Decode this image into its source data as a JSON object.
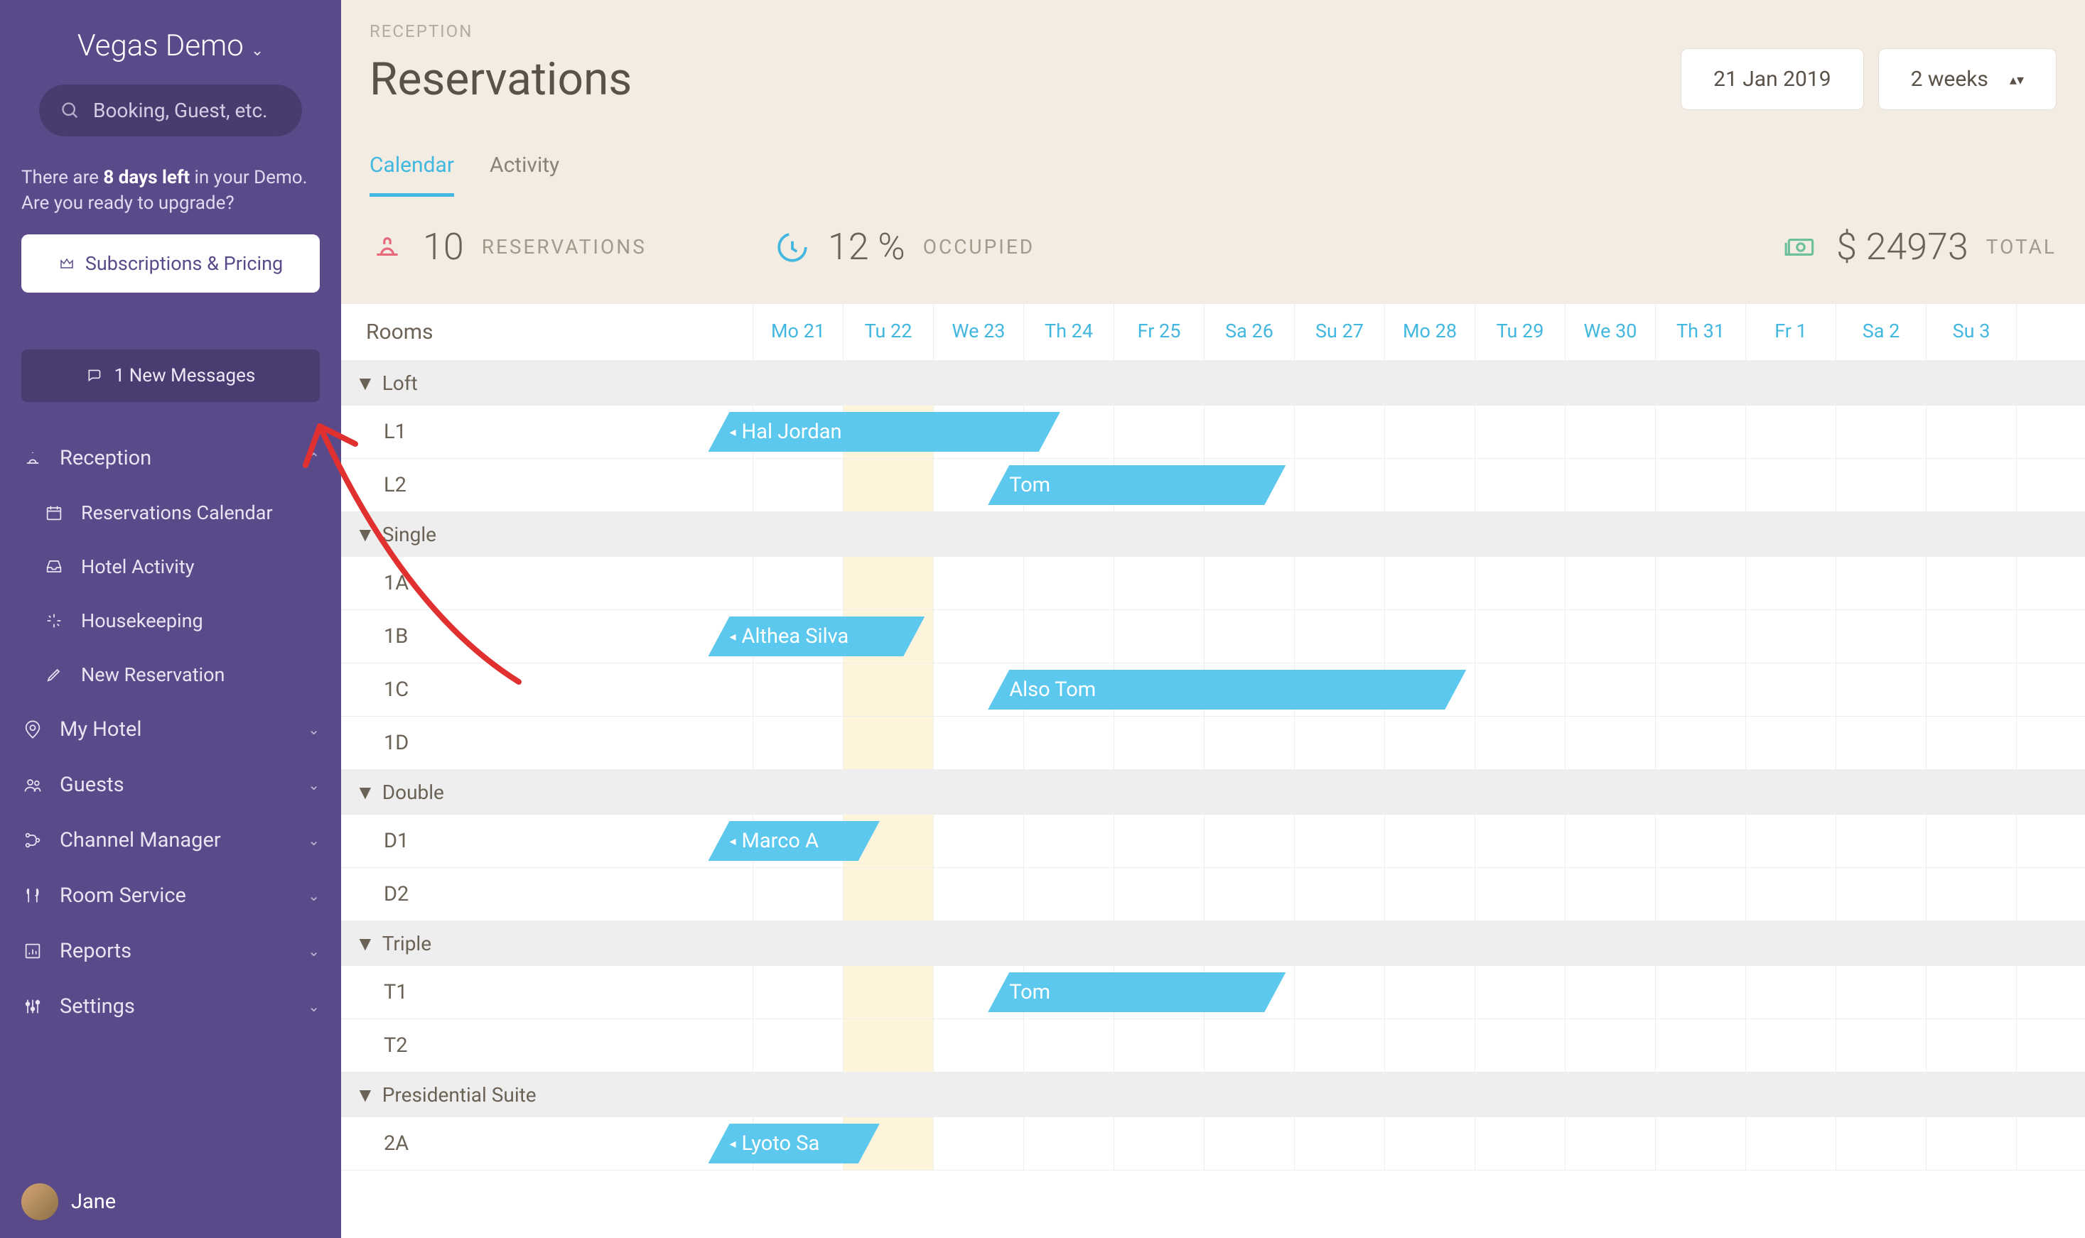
{
  "sidebar": {
    "org_name": "Vegas Demo",
    "search_placeholder": "Booking, Guest, etc.",
    "demo_note_prefix": "There are ",
    "demo_note_bold": "8 days left",
    "demo_note_suffix": " in your Demo. Are you ready to upgrade?",
    "pricing_button": "Subscriptions & Pricing",
    "messages_button": "1 New Messages",
    "nav": [
      {
        "label": "Reception",
        "icon": "bell",
        "expanded": true,
        "children": [
          {
            "label": "Reservations Calendar",
            "icon": "calendar"
          },
          {
            "label": "Hotel Activity",
            "icon": "inbox"
          },
          {
            "label": "Housekeeping",
            "icon": "sparkle"
          },
          {
            "label": "New Reservation",
            "icon": "edit"
          }
        ]
      },
      {
        "label": "My Hotel",
        "icon": "pin"
      },
      {
        "label": "Guests",
        "icon": "users"
      },
      {
        "label": "Channel Manager",
        "icon": "branch"
      },
      {
        "label": "Room Service",
        "icon": "food"
      },
      {
        "label": "Reports",
        "icon": "report"
      },
      {
        "label": "Settings",
        "icon": "sliders"
      }
    ],
    "user_name": "Jane"
  },
  "header": {
    "breadcrumb": "RECEPTION",
    "title": "Reservations",
    "date_picker": "21 Jan 2019",
    "range_picker": "2 weeks",
    "tabs": [
      {
        "label": "Calendar",
        "active": true
      },
      {
        "label": "Activity",
        "active": false
      }
    ]
  },
  "stats": {
    "reservations_value": "10",
    "reservations_label": "RESERVATIONS",
    "occupied_value": "12 %",
    "occupied_label": "OCCUPIED",
    "total_value": "$ 24973",
    "total_label": "TOTAL"
  },
  "calendar": {
    "rooms_header": "Rooms",
    "today_index": 1,
    "days": [
      "Mo 21",
      "Tu 22",
      "We 23",
      "Th 24",
      "Fr 25",
      "Sa 26",
      "Su 27",
      "Mo 28",
      "Tu 29",
      "We 30",
      "Th 31",
      "Fr 1",
      "Sa 2",
      "Su 3"
    ],
    "sections": [
      {
        "name": "Loft",
        "rooms": [
          {
            "name": "L1",
            "bookings": [
              {
                "guest": "Hal Jordan",
                "start": -0.5,
                "span": 3.9,
                "arrow": true
              }
            ]
          },
          {
            "name": "L2",
            "bookings": [
              {
                "guest": "Tom",
                "start": 2.6,
                "span": 3.3
              }
            ]
          }
        ]
      },
      {
        "name": "Single",
        "rooms": [
          {
            "name": "1A",
            "bookings": []
          },
          {
            "name": "1B",
            "bookings": [
              {
                "guest": "Althea Silva",
                "start": -0.5,
                "span": 2.4,
                "arrow": true
              }
            ]
          },
          {
            "name": "1C",
            "bookings": [
              {
                "guest": "Also Tom",
                "start": 2.6,
                "span": 5.3
              }
            ]
          },
          {
            "name": "1D",
            "bookings": []
          }
        ]
      },
      {
        "name": "Double",
        "rooms": [
          {
            "name": "D1",
            "bookings": [
              {
                "guest": "Marco A",
                "start": -0.5,
                "span": 1.9,
                "arrow": true,
                "truncated": true
              }
            ]
          },
          {
            "name": "D2",
            "bookings": []
          }
        ]
      },
      {
        "name": "Triple",
        "rooms": [
          {
            "name": "T1",
            "bookings": [
              {
                "guest": "Tom",
                "start": 2.6,
                "span": 3.3
              }
            ]
          },
          {
            "name": "T2",
            "bookings": []
          }
        ]
      },
      {
        "name": "Presidential Suite",
        "rooms": [
          {
            "name": "2A",
            "bookings": [
              {
                "guest": "Lyoto Sa",
                "start": -0.5,
                "span": 1.9,
                "arrow": true,
                "truncated": true
              }
            ]
          }
        ]
      }
    ]
  }
}
